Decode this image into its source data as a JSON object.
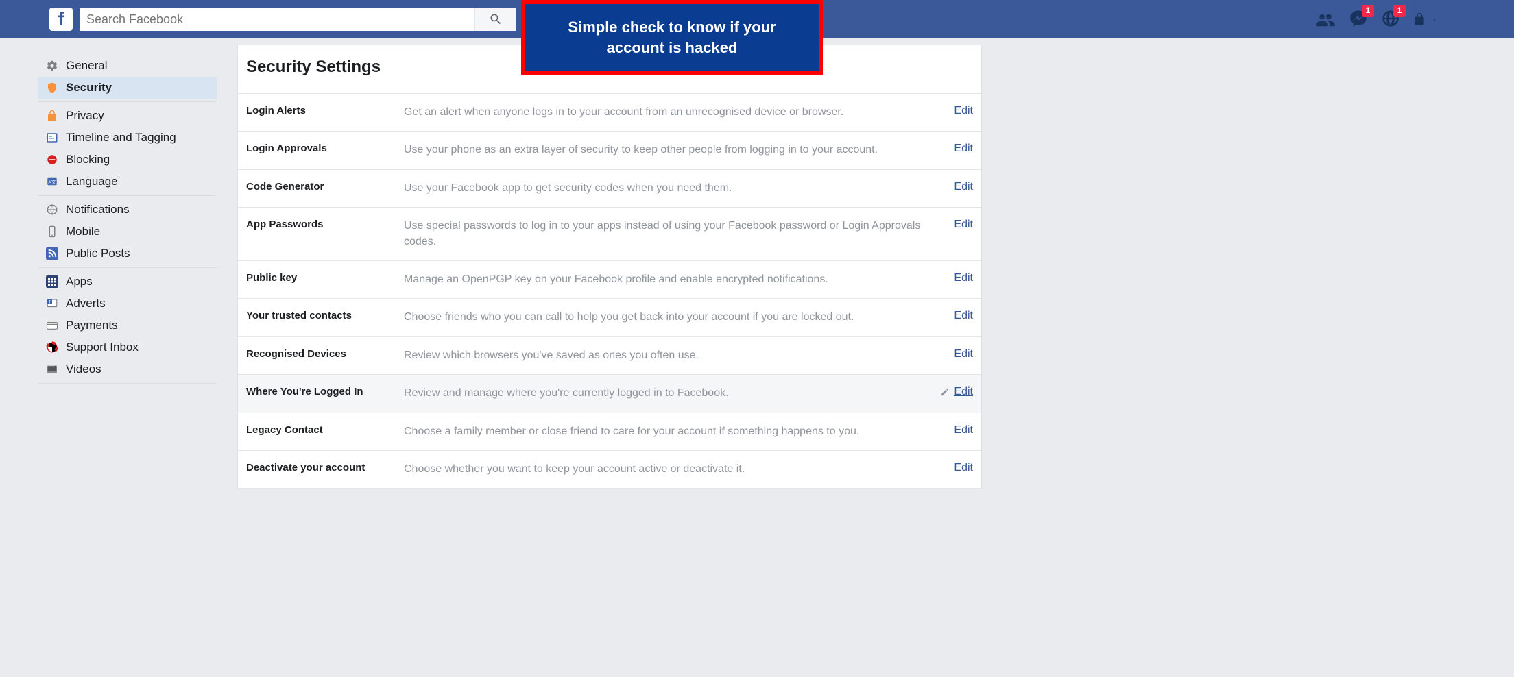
{
  "search": {
    "placeholder": "Search Facebook"
  },
  "badges": {
    "messages": "1",
    "notifications": "1"
  },
  "callout": "Simple check to know if your account is hacked",
  "sidebar": {
    "groups": [
      {
        "items": [
          {
            "label": "General",
            "icon": "gear"
          },
          {
            "label": "Security",
            "icon": "shield",
            "active": true
          }
        ]
      },
      {
        "items": [
          {
            "label": "Privacy",
            "icon": "lock"
          },
          {
            "label": "Timeline and Tagging",
            "icon": "timeline"
          },
          {
            "label": "Blocking",
            "icon": "block"
          },
          {
            "label": "Language",
            "icon": "language"
          }
        ]
      },
      {
        "items": [
          {
            "label": "Notifications",
            "icon": "globe"
          },
          {
            "label": "Mobile",
            "icon": "mobile"
          },
          {
            "label": "Public Posts",
            "icon": "rss"
          }
        ]
      },
      {
        "items": [
          {
            "label": "Apps",
            "icon": "apps"
          },
          {
            "label": "Adverts",
            "icon": "adverts"
          },
          {
            "label": "Payments",
            "icon": "payments"
          },
          {
            "label": "Support Inbox",
            "icon": "support"
          },
          {
            "label": "Videos",
            "icon": "videos"
          }
        ]
      }
    ]
  },
  "page_title": "Security Settings",
  "edit_label": "Edit",
  "settings": [
    {
      "label": "Login Alerts",
      "desc": "Get an alert when anyone logs in to your account from an unrecognised device or browser."
    },
    {
      "label": "Login Approvals",
      "desc": "Use your phone as an extra layer of security to keep other people from logging in to your account."
    },
    {
      "label": "Code Generator",
      "desc": "Use your Facebook app to get security codes when you need them."
    },
    {
      "label": "App Passwords",
      "desc": "Use special passwords to log in to your apps instead of using your Facebook password or Login Approvals codes."
    },
    {
      "label": "Public key",
      "desc": "Manage an OpenPGP key on your Facebook profile and enable encrypted notifications."
    },
    {
      "label": "Your trusted contacts",
      "desc": "Choose friends who you can call to help you get back into your account if you are locked out."
    },
    {
      "label": "Recognised Devices",
      "desc": "Review which browsers you've saved as ones you often use."
    },
    {
      "label": "Where You're Logged In",
      "desc": "Review and manage where you're currently logged in to Facebook.",
      "highlight": true,
      "pencil": true
    },
    {
      "label": "Legacy Contact",
      "desc": "Choose a family member or close friend to care for your account if something happens to you."
    },
    {
      "label": "Deactivate your account",
      "desc": "Choose whether you want to keep your account active or deactivate it."
    }
  ]
}
